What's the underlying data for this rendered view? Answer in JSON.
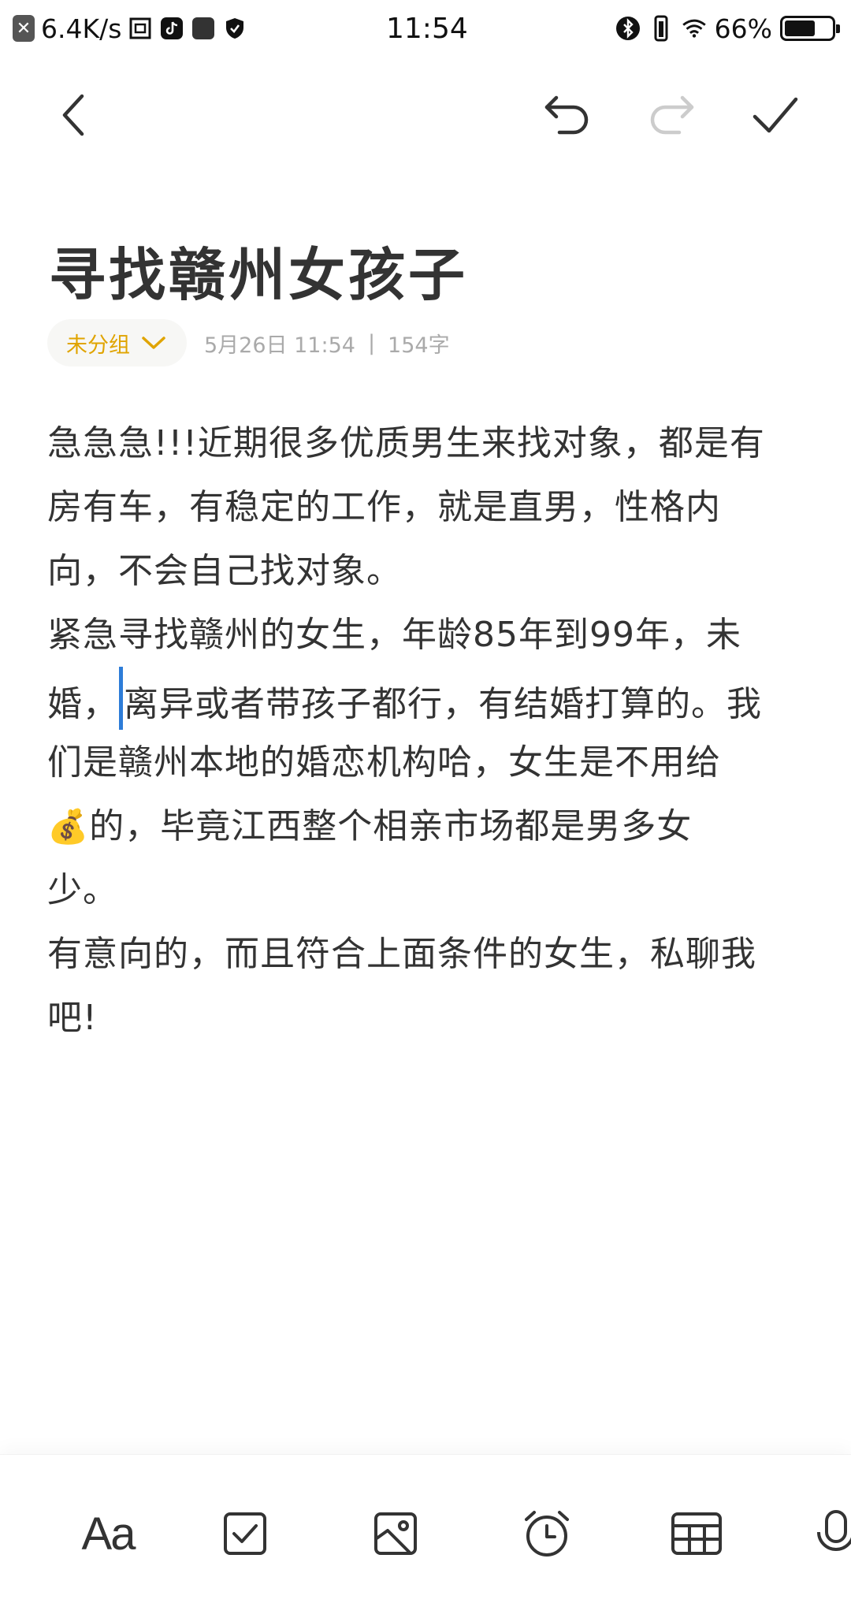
{
  "status_bar": {
    "net_speed": "6.4K/s",
    "time": "11:54",
    "battery_percent": "66%",
    "battery_level": 0.66,
    "icons": [
      "close-notify-icon",
      "net-speed-icon",
      "app-icon",
      "tiktok-icon",
      "square-app-icon",
      "shield-icon",
      "bluetooth-icon",
      "vibrate-icon",
      "wifi-icon",
      "battery-icon"
    ]
  },
  "toolbar": {
    "back_icon": "chevron-left-icon",
    "undo_icon": "undo-icon",
    "redo_icon": "redo-icon",
    "done_icon": "checkmark-icon"
  },
  "note": {
    "title": "寻找赣州女孩子",
    "group_label": "未分组",
    "date": "5月26日 11:54",
    "separator": "|",
    "word_count": "154字",
    "lines": [
      "急急急!!!近期很多优质男生来找对象，都是有",
      "房有车，有稳定的工作，就是直男，性格内",
      "向，不会自己找对象。",
      "紧急寻找赣州的女生，年龄85年到99年，未"
    ],
    "line5_before_cursor": "婚，",
    "line5_after_cursor": "离异或者带孩子都行，有结婚打算的。我",
    "line6": "们是赣州本地的婚恋机构哈，女生是不用给",
    "line7_emoji": "💰",
    "line7_text": "的，毕竟江西整个相亲市场都是男多女",
    "line8": "少。",
    "line9": "有意向的，而且符合上面条件的女生，私聊我",
    "line10": "吧!"
  },
  "bottom_toolbar": {
    "text_format_label": "Aa",
    "items": [
      "text-format",
      "checklist-icon",
      "image-icon",
      "alarm-icon",
      "table-icon",
      "microphone-icon"
    ]
  },
  "colors": {
    "accent_yellow": "#e0a400",
    "cursor_blue": "#2d7cd8",
    "text": "#333333",
    "meta_gray": "#aaaaaa"
  }
}
